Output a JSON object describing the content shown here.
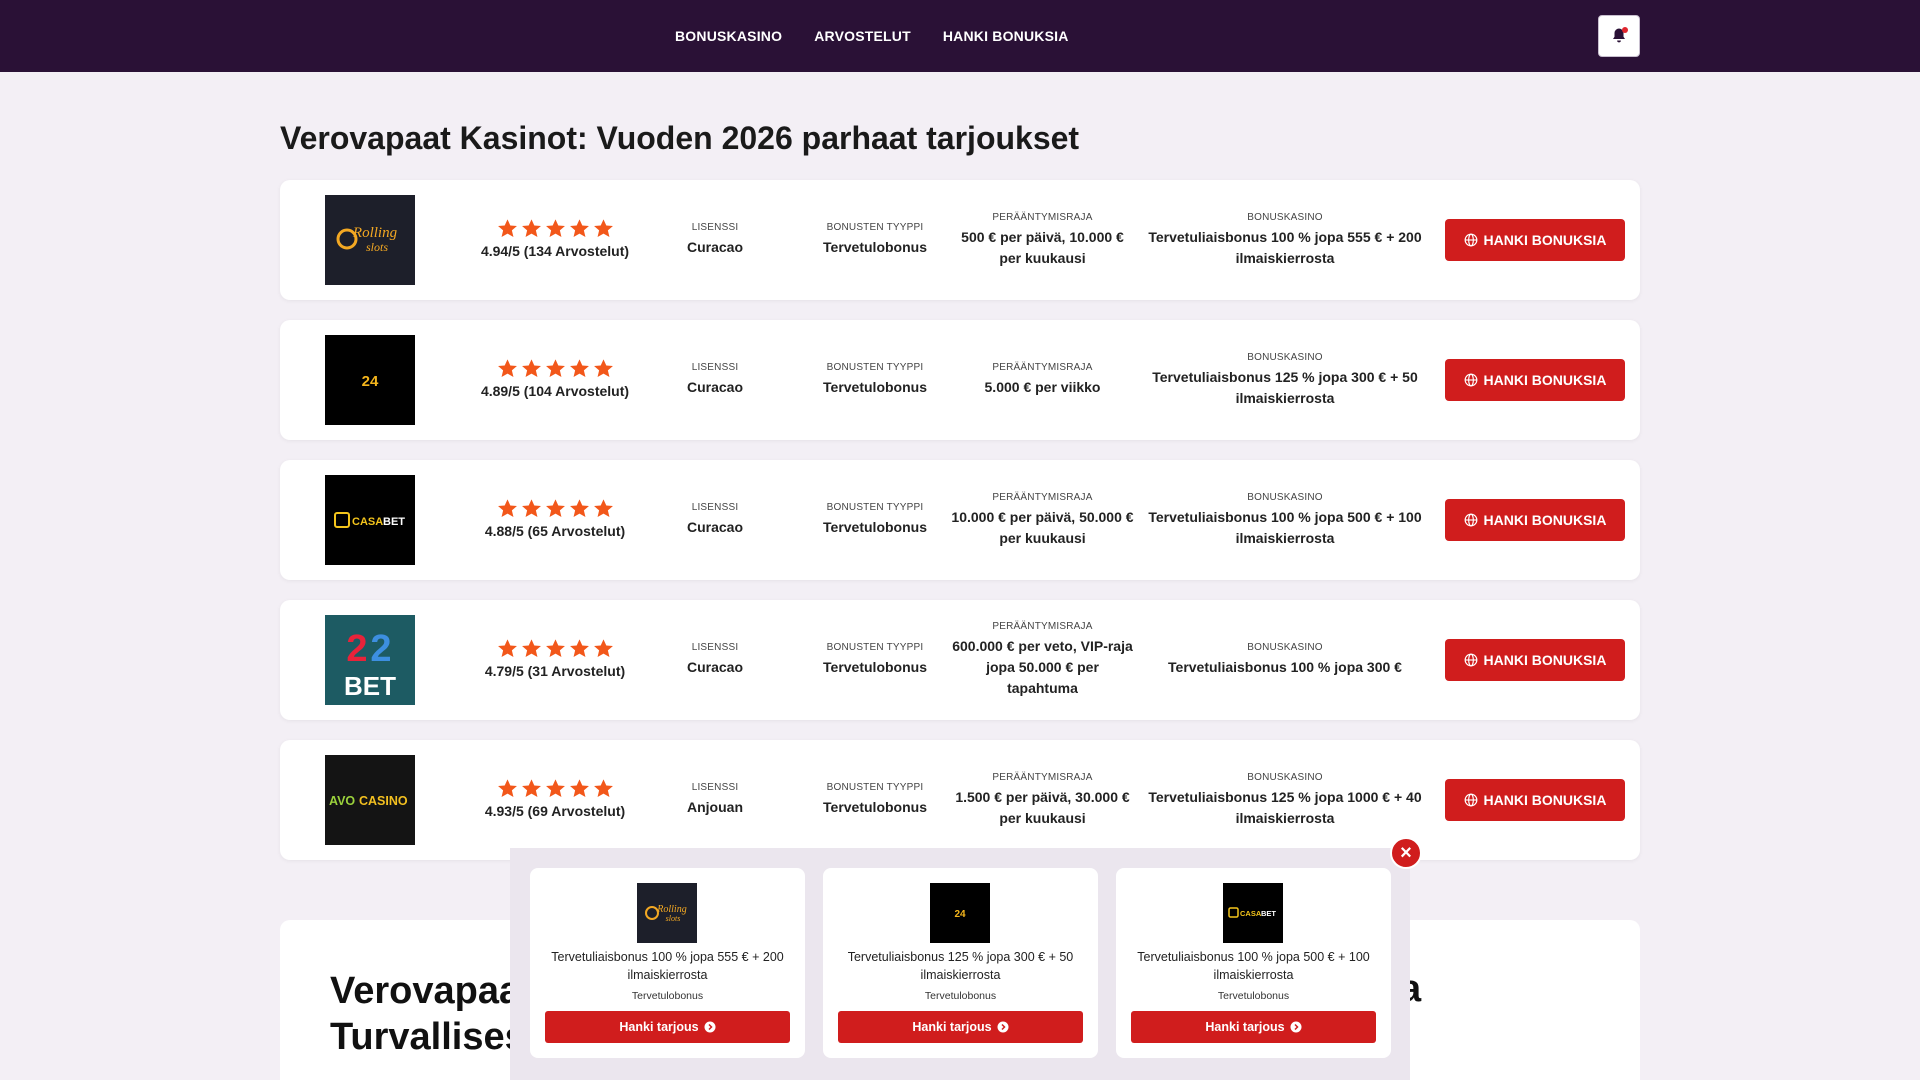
{
  "nav": {
    "items": [
      {
        "label": "BONUSKASINO"
      },
      {
        "label": "ARVOSTELUT"
      },
      {
        "label": "HANKI BONUKSIA"
      }
    ]
  },
  "page_title": "Verovapaat Kasinot: Vuoden 2026 parhaat tarjoukset",
  "labels": {
    "license": "LISENSSI",
    "bonus_type": "BONUSTEN TYYPPI",
    "withdrawal_limit": "PERÄÄNTYMISRAJA",
    "bonus_casino": "BONUSKASINO",
    "cta": "HANKI BONUKSIA"
  },
  "casinos": [
    {
      "logo_icon": "rolling-slots-logo",
      "logo_text": "Rolling slots",
      "rating_text": "4.94/5 (134 Arvostelut)",
      "stars": 5,
      "license": "Curacao",
      "bonus_type": "Tervetulobonus",
      "limit": "500 € per päivä, 10.000 € per kuukausi",
      "bonus": "Tervetuliaisbonus 100 % jopa 555 € + 200 ilmaiskierrosta"
    },
    {
      "logo_icon": "24slots-logo",
      "logo_text": "24SLOTS",
      "rating_text": "4.89/5 (104 Arvostelut)",
      "stars": 5,
      "license": "Curacao",
      "bonus_type": "Tervetulobonus",
      "limit": "5.000 € per viikko",
      "bonus": "Tervetuliaisbonus 125 % jopa 300 € + 50 ilmaiskierrosta"
    },
    {
      "logo_icon": "casabet-logo",
      "logo_text": "CASABET",
      "rating_text": "4.88/5 (65 Arvostelut)",
      "stars": 5,
      "license": "Curacao",
      "bonus_type": "Tervetulobonus",
      "limit": "10.000 € per päivä, 50.000 € per kuukausi",
      "bonus": "Tervetuliaisbonus 100 % jopa 500 € + 100 ilmaiskierrosta"
    },
    {
      "logo_icon": "22bet-logo",
      "logo_text": "BET",
      "rating_text": "4.79/5 (31 Arvostelut)",
      "stars": 5,
      "license": "Curacao",
      "bonus_type": "Tervetulobonus",
      "limit": "600.000 € per veto, VIP-raja jopa 50.000 € per tapahtuma",
      "bonus": "Tervetuliaisbonus 100 % jopa 300 €"
    },
    {
      "logo_icon": "avocasino-logo",
      "logo_text": "AVOCASINO",
      "rating_text": "4.93/5 (69 Arvostelut)",
      "stars": 5,
      "license": "Anjouan",
      "bonus_type": "Tervetulobonus",
      "limit": "1.500 € per päivä, 30.000 € per kuukausi",
      "bonus": "Tervetuliaisbonus 125 % jopa 1000 € + 40 ilmaiskierrosta"
    }
  ],
  "lower": {
    "title_line1": "Verovapaat",
    "title_line2": "Turvallises",
    "title_tail": "a"
  },
  "popup": {
    "cta": "Hanki tarjous",
    "close": "×",
    "offers": [
      {
        "logo_icon": "rolling-slots-logo",
        "logo_text": "Rolling slots",
        "bonus": "Tervetuliaisbonus 100 % jopa 555 € + 200 ilmaiskierrosta",
        "type": "Tervetulobonus"
      },
      {
        "logo_icon": "24slots-logo",
        "logo_text": "24SLOTS",
        "bonus": "Tervetuliaisbonus 125 % jopa 300 € + 50 ilmaiskierrosta",
        "type": "Tervetulobonus"
      },
      {
        "logo_icon": "casabet-logo",
        "logo_text": "CASABET",
        "bonus": "Tervetuliaisbonus 100 % jopa 500 € + 100 ilmaiskierrosta",
        "type": "Tervetulobonus"
      }
    ]
  },
  "colors": {
    "header_bg": "#2a1136",
    "page_bg": "#f3eff5",
    "cta_red": "#d01d1d",
    "star_orange": "#f2571a"
  }
}
